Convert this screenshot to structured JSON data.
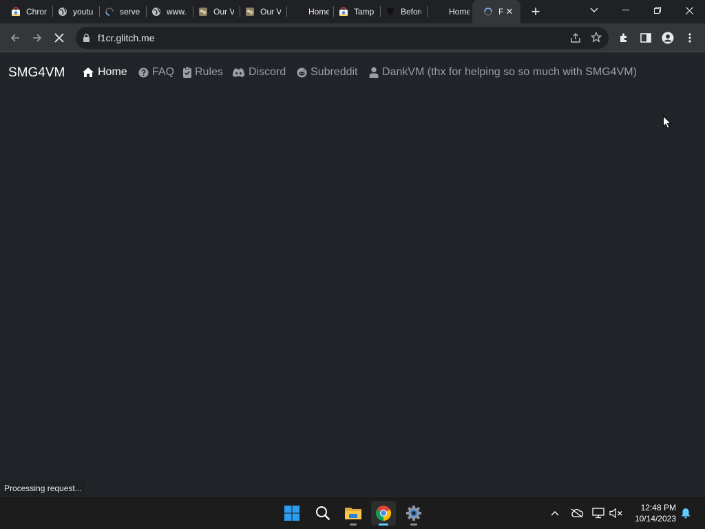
{
  "browser": {
    "tabs": [
      {
        "title": "Chrome",
        "icon": "chrome-web-store-icon"
      },
      {
        "title": "youtube",
        "icon": "globe-icon"
      },
      {
        "title": "server",
        "icon": "loading-spinner-icon"
      },
      {
        "title": "www.",
        "icon": "globe-icon"
      },
      {
        "title": "Our V",
        "icon": "gif-favicon-icon"
      },
      {
        "title": "Our V",
        "icon": "gif-favicon-icon"
      },
      {
        "title": "Home",
        "icon": "none"
      },
      {
        "title": "Tamp",
        "icon": "chrome-web-store-icon"
      },
      {
        "title": "Before",
        "icon": "dark-shield-icon"
      },
      {
        "title": "Home",
        "icon": "none"
      },
      {
        "title": "F",
        "icon": "loading-spinner-icon",
        "active": true
      }
    ],
    "url": "f1cr.glitch.me",
    "status_text": "Processing request..."
  },
  "site": {
    "brand": "SMG4VM",
    "nav": [
      {
        "label": "Home",
        "icon": "home-icon",
        "active": true
      },
      {
        "label": "FAQ",
        "icon": "question-circle-icon"
      },
      {
        "label": "Rules",
        "icon": "clipboard-check-icon"
      },
      {
        "label": "Discord",
        "icon": "discord-icon"
      },
      {
        "label": "Subreddit",
        "icon": "reddit-icon"
      },
      {
        "label": "DankVM (thx for helping so so much with SMG4VM)",
        "icon": "user-icon"
      }
    ]
  },
  "taskbar": {
    "time": "12:48 PM",
    "date": "10/14/2023",
    "apps": [
      "start-icon",
      "search-icon",
      "file-explorer-icon",
      "chrome-icon",
      "settings-icon"
    ]
  },
  "colors": {
    "page_bg": "#212529",
    "chrome_frame": "#202124",
    "toolbar": "#35363a",
    "accent": "#60cdff"
  }
}
